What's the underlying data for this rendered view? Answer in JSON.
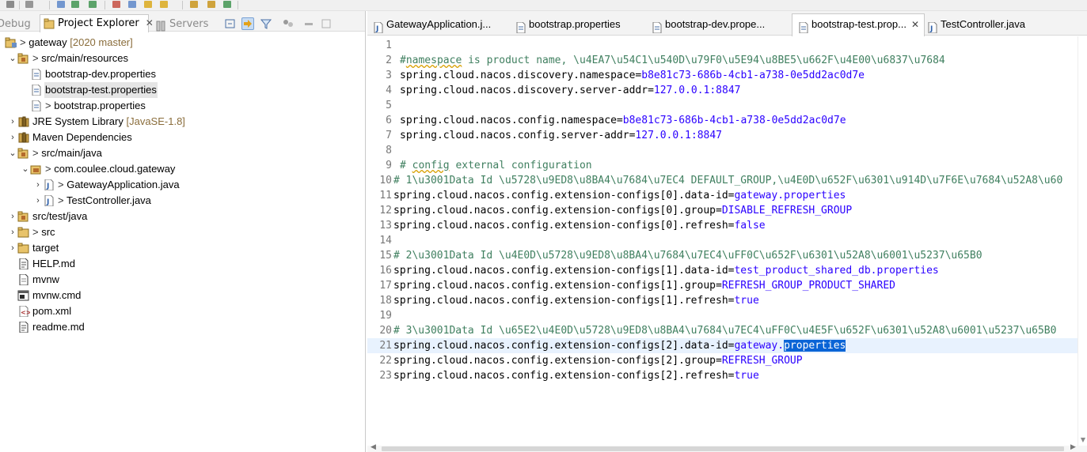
{
  "toolbar": {
    "icons": [
      "save-icon",
      "save-all-icon",
      "print-icon",
      "debug-icon",
      "run-icon",
      "external-tools-icon",
      "search-icon",
      "open-folder-icon",
      "annotation-icon",
      "back-icon",
      "forward-icon",
      "pin-editor-icon"
    ]
  },
  "views": {
    "debug": "Debug",
    "project_explorer": "Project Explorer",
    "servers": "Servers",
    "close": "✕"
  },
  "tree": [
    {
      "indent": 0,
      "twisty": "",
      "icon": "project-icon",
      "prefix": "> ",
      "label": "gateway",
      "deco": " [2020 master]"
    },
    {
      "indent": 1,
      "twisty": "expanded",
      "icon": "source-folder-icon",
      "prefix": "> ",
      "label": "src/main/resources",
      "deco": ""
    },
    {
      "indent": 2,
      "twisty": "",
      "icon": "properties-file-icon",
      "prefix": "",
      "label": "bootstrap-dev.properties",
      "deco": ""
    },
    {
      "indent": 2,
      "twisty": "",
      "icon": "properties-file-icon",
      "prefix": "",
      "label": "bootstrap-test.properties",
      "deco": "",
      "selected": true
    },
    {
      "indent": 2,
      "twisty": "",
      "icon": "properties-file-icon",
      "prefix": "> ",
      "label": "bootstrap.properties",
      "deco": ""
    },
    {
      "indent": 1,
      "twisty": "collapsed",
      "icon": "library-icon",
      "prefix": "",
      "label": "JRE System Library",
      "deco": " [JavaSE-1.8]"
    },
    {
      "indent": 1,
      "twisty": "collapsed",
      "icon": "library-icon",
      "prefix": "",
      "label": "Maven Dependencies",
      "deco": ""
    },
    {
      "indent": 1,
      "twisty": "expanded",
      "icon": "source-folder-icon",
      "prefix": "> ",
      "label": "src/main/java",
      "deco": ""
    },
    {
      "indent": 2,
      "twisty": "expanded",
      "icon": "package-icon",
      "prefix": "> ",
      "label": "com.coulee.cloud.gateway",
      "deco": ""
    },
    {
      "indent": 3,
      "twisty": "collapsed",
      "icon": "java-file-icon",
      "prefix": "> ",
      "label": "GatewayApplication.java",
      "deco": ""
    },
    {
      "indent": 3,
      "twisty": "collapsed",
      "icon": "java-file-icon",
      "prefix": "> ",
      "label": "TestController.java",
      "deco": ""
    },
    {
      "indent": 1,
      "twisty": "collapsed",
      "icon": "source-folder-icon",
      "prefix": "",
      "label": "src/test/java",
      "deco": ""
    },
    {
      "indent": 1,
      "twisty": "collapsed",
      "icon": "folder-icon",
      "prefix": "> ",
      "label": "src",
      "deco": ""
    },
    {
      "indent": 1,
      "twisty": "collapsed",
      "icon": "folder-icon",
      "prefix": "",
      "label": "target",
      "deco": ""
    },
    {
      "indent": 1,
      "twisty": "",
      "icon": "markdown-file-icon",
      "prefix": "",
      "label": "HELP.md",
      "deco": ""
    },
    {
      "indent": 1,
      "twisty": "",
      "icon": "text-file-icon",
      "prefix": "",
      "label": "mvnw",
      "deco": ""
    },
    {
      "indent": 1,
      "twisty": "",
      "icon": "cmd-file-icon",
      "prefix": "",
      "label": "mvnw.cmd",
      "deco": ""
    },
    {
      "indent": 1,
      "twisty": "",
      "icon": "xml-file-icon",
      "prefix": "",
      "label": "pom.xml",
      "deco": ""
    },
    {
      "indent": 1,
      "twisty": "",
      "icon": "markdown-file-icon",
      "prefix": "",
      "label": "readme.md",
      "deco": ""
    }
  ],
  "editor_tabs": [
    {
      "label": "GatewayApplication.j...",
      "icon": "java-file-icon",
      "active": false
    },
    {
      "label": "bootstrap.properties",
      "icon": "properties-file-icon",
      "active": false
    },
    {
      "label": "bootstrap-dev.prope...",
      "icon": "properties-file-icon",
      "active": false
    },
    {
      "label": "bootstrap-test.prop...",
      "icon": "properties-file-icon",
      "active": true
    },
    {
      "label": "TestController.java",
      "icon": "java-file-icon",
      "active": false
    }
  ],
  "code_lines": [
    {
      "n": "1",
      "parts": []
    },
    {
      "n": "2",
      "parts": [
        {
          "t": "#",
          "c": "cm"
        },
        {
          "t": "namespace",
          "c": "cm ul"
        },
        {
          "t": " is product name, \\u4EA7\\u54C1\\u540D\\u79F0\\u5E94\\u8BE5\\u662F\\u4E00\\u6837\\u7684",
          "c": "cm"
        }
      ]
    },
    {
      "n": "3",
      "parts": [
        {
          "t": "spring.cloud.nacos.discovery.namespace=",
          "c": ""
        },
        {
          "t": "b8e81c73-686b-4cb1-a738-0e5dd2ac0d7e",
          "c": "val"
        }
      ]
    },
    {
      "n": "4",
      "parts": [
        {
          "t": "spring.cloud.nacos.discovery.server-addr=",
          "c": ""
        },
        {
          "t": "127.0.0.1:8847",
          "c": "val"
        }
      ]
    },
    {
      "n": "5",
      "parts": []
    },
    {
      "n": "6",
      "parts": [
        {
          "t": "spring.cloud.nacos.config.namespace=",
          "c": ""
        },
        {
          "t": "b8e81c73-686b-4cb1-a738-0e5dd2ac0d7e",
          "c": "val"
        }
      ]
    },
    {
      "n": "7",
      "parts": [
        {
          "t": "spring.cloud.nacos.config.server-addr=",
          "c": ""
        },
        {
          "t": "127.0.0.1:8847",
          "c": "val"
        }
      ]
    },
    {
      "n": "8",
      "parts": []
    },
    {
      "n": "9",
      "parts": [
        {
          "t": "# ",
          "c": "cm"
        },
        {
          "t": "config",
          "c": "cm ul"
        },
        {
          "t": " external configuration",
          "c": "cm"
        }
      ]
    },
    {
      "n": "10",
      "parts": [
        {
          "t": "# 1\\u3001Data Id \\u5728\\u9ED8\\u8BA4\\u7684\\u7EC4 DEFAULT_GROUP,\\u4E0D\\u652F\\u6301\\u914D\\u7F6E\\u7684\\u52A8\\u60",
          "c": "cm"
        }
      ]
    },
    {
      "n": "11",
      "parts": [
        {
          "t": "spring.cloud.nacos.config.extension-configs[0].data-id=",
          "c": ""
        },
        {
          "t": "gateway.properties",
          "c": "val"
        }
      ]
    },
    {
      "n": "12",
      "parts": [
        {
          "t": "spring.cloud.nacos.config.extension-configs[0].group=",
          "c": ""
        },
        {
          "t": "DISABLE_REFRESH_GROUP",
          "c": "val"
        }
      ]
    },
    {
      "n": "13",
      "parts": [
        {
          "t": "spring.cloud.nacos.config.extension-configs[0].refresh=",
          "c": ""
        },
        {
          "t": "false",
          "c": "val"
        }
      ]
    },
    {
      "n": "14",
      "parts": []
    },
    {
      "n": "15",
      "parts": [
        {
          "t": "# 2\\u3001Data Id \\u4E0D\\u5728\\u9ED8\\u8BA4\\u7684\\u7EC4\\uFF0C\\u652F\\u6301\\u52A8\\u6001\\u5237\\u65B0",
          "c": "cm"
        }
      ]
    },
    {
      "n": "16",
      "parts": [
        {
          "t": "spring.cloud.nacos.config.extension-configs[1].data-id=",
          "c": ""
        },
        {
          "t": "test_product_shared_db.properties",
          "c": "val"
        }
      ]
    },
    {
      "n": "17",
      "parts": [
        {
          "t": "spring.cloud.nacos.config.extension-configs[1].group=",
          "c": ""
        },
        {
          "t": "REFRESH_GROUP_PRODUCT_SHARED",
          "c": "val"
        }
      ]
    },
    {
      "n": "18",
      "parts": [
        {
          "t": "spring.cloud.nacos.config.extension-configs[1].refresh=",
          "c": ""
        },
        {
          "t": "true",
          "c": "val"
        }
      ]
    },
    {
      "n": "19",
      "parts": []
    },
    {
      "n": "20",
      "parts": [
        {
          "t": "# 3\\u3001Data Id \\u65E2\\u4E0D\\u5728\\u9ED8\\u8BA4\\u7684\\u7EC4\\uFF0C\\u4E5F\\u652F\\u6301\\u52A8\\u6001\\u5237\\u65B0",
          "c": "cm"
        }
      ]
    },
    {
      "n": "21",
      "current": true,
      "parts": [
        {
          "t": "spring.cloud.nacos.config.extension-configs[2].data-id=",
          "c": ""
        },
        {
          "t": "gateway.",
          "c": "val"
        },
        {
          "t": "properties",
          "c": "val hl"
        }
      ]
    },
    {
      "n": "22",
      "parts": [
        {
          "t": "spring.cloud.nacos.config.extension-configs[2].group=",
          "c": ""
        },
        {
          "t": "REFRESH_GROUP",
          "c": "val"
        }
      ]
    },
    {
      "n": "23",
      "parts": [
        {
          "t": "spring.cloud.nacos.config.extension-configs[2].refresh=",
          "c": ""
        },
        {
          "t": "true",
          "c": "val"
        }
      ]
    }
  ],
  "colors": {
    "comment": "#3f7f5f",
    "value": "#2a00ff",
    "selection": "#0a64d6",
    "current_line": "#e8f2fe"
  }
}
